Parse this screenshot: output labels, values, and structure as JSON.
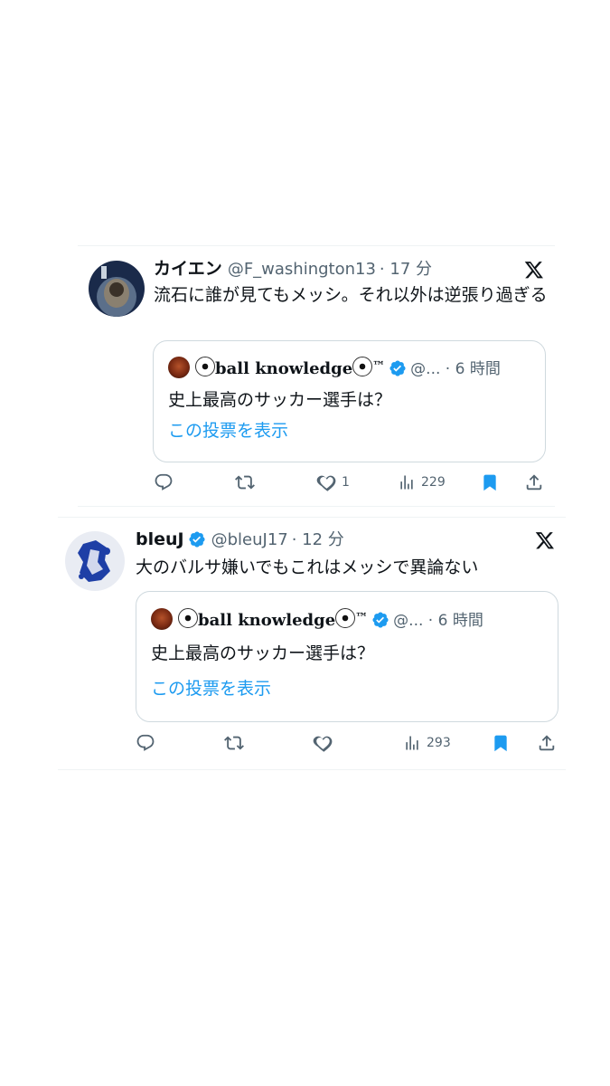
{
  "tweets": [
    {
      "name": "カイエン",
      "handle": "@F_washington13",
      "time": "· 17 分",
      "text": "流石に誰が見てもメッシ。それ以外は逆張り過ぎる",
      "quote": {
        "name_prefix": "⚽",
        "name": "ball knowledge",
        "name_suffix": "⚽™",
        "meta": "@... · 6 時間",
        "text": "史上最高のサッカー選手は？",
        "link": "この投票を表示"
      },
      "actions": {
        "likes": "1",
        "views": "229"
      }
    },
    {
      "name": "bleuJ",
      "handle": "@bleuJ17",
      "time": "· 12 分",
      "text": "大のバルサ嫌いでもこれはメッシで異論ない",
      "quote": {
        "name_prefix": "⚽",
        "name": "ball knowledge",
        "name_suffix": "⚽™",
        "meta": "@... · 6 時間",
        "text": "史上最高のサッカー選手は？",
        "link": "この投票を表示"
      },
      "actions": {
        "likes": "",
        "views": "293"
      }
    }
  ],
  "colors": {
    "accent": "#1d9bf0",
    "muted": "#536471",
    "text": "#0f1419"
  },
  "icons": [
    "reply-icon",
    "retweet-icon",
    "like-icon",
    "views-icon",
    "bookmark-icon",
    "share-icon",
    "x-logo-icon",
    "verified-badge-icon"
  ]
}
